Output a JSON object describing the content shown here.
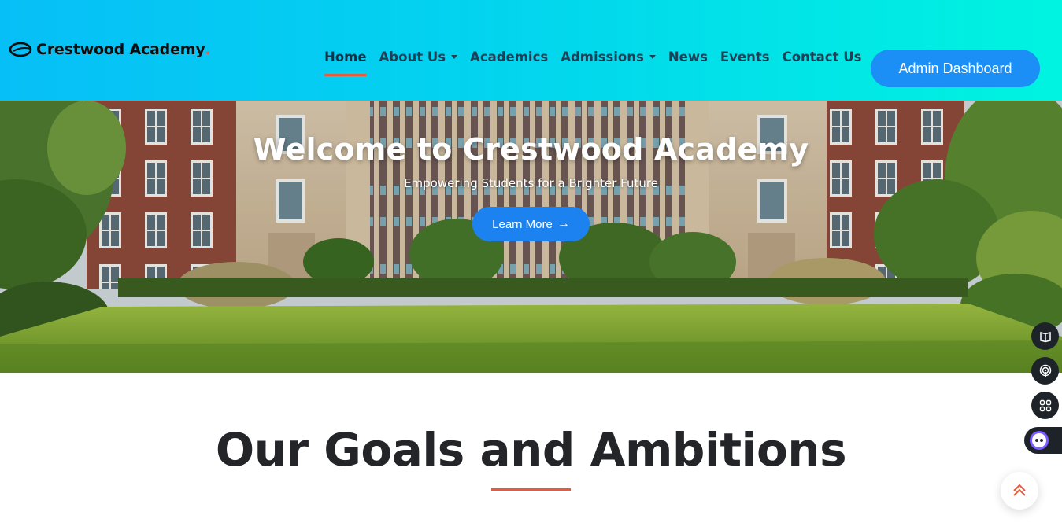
{
  "header": {
    "logo_text": "Crestwood Academy",
    "logo_dot": ".",
    "nav": [
      {
        "label": "Home",
        "active": true,
        "dropdown": false
      },
      {
        "label": "About Us",
        "active": false,
        "dropdown": true
      },
      {
        "label": "Academics",
        "active": false,
        "dropdown": false
      },
      {
        "label": "Admissions",
        "active": false,
        "dropdown": true
      },
      {
        "label": "News",
        "active": false,
        "dropdown": false
      },
      {
        "label": "Events",
        "active": false,
        "dropdown": false
      },
      {
        "label": "Contact Us",
        "active": false,
        "dropdown": false
      }
    ],
    "admin_button": "Admin Dashboard"
  },
  "hero": {
    "title": "Welcome to Crestwood Academy",
    "subtitle": "Empowering Students for a Brighter Future",
    "cta_label": "Learn More",
    "cta_icon": "arrow-right-icon"
  },
  "side_widgets": [
    "book-icon",
    "podcast-icon",
    "apps-grid-icon",
    "ai-assistant-icon"
  ],
  "scroll_top_icon": "double-chevron-up-icon",
  "goals": {
    "title": "Our Goals and Ambitions"
  },
  "colors": {
    "header_gradient_start": "#07bff7",
    "header_gradient_end": "#00f3e0",
    "accent": "#e9593a",
    "primary_button": "#1b8ff5"
  }
}
